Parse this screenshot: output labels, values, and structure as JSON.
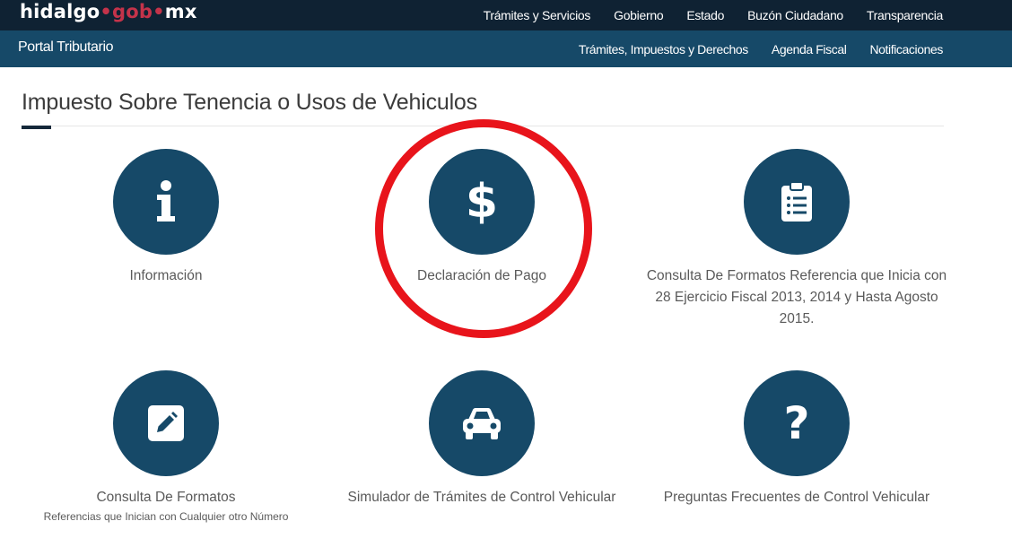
{
  "header": {
    "logo": {
      "part1": "hidalgo",
      "part2": "gob",
      "part3": "mx"
    },
    "nav": [
      "Trámites y Servicios",
      "Gobierno",
      "Estado",
      "Buzón Ciudadano",
      "Transparencia"
    ]
  },
  "subheader": {
    "title": "Portal Tributario",
    "nav": [
      "Trámites, Impuestos y Derechos",
      "Agenda Fiscal",
      "Notificaciones"
    ]
  },
  "page": {
    "title": "Impuesto Sobre Tenencia o Usos de Vehiculos"
  },
  "tiles": [
    {
      "label": "Información",
      "icon": "info-icon"
    },
    {
      "label": "Declaración de Pago",
      "icon": "dollar-icon"
    },
    {
      "label": "Consulta De Formatos Referencia que Inicia con 28 Ejercicio Fiscal 2013, 2014 y Hasta Agosto 2015.",
      "icon": "clipboard-list-icon"
    },
    {
      "label": "Consulta De Formatos",
      "sublabel": "Referencias que Inician con Cualquier otro Número",
      "icon": "edit-icon"
    },
    {
      "label": "Simulador de Trámites de Control Vehicular",
      "icon": "car-icon"
    },
    {
      "label": "Preguntas Frecuentes de Control Vehicular",
      "icon": "question-icon"
    }
  ],
  "colors": {
    "topbar": "#0f2233",
    "subbar": "#164968",
    "icon_circle": "#164968",
    "logo_accent": "#c4334a",
    "highlight": "#e8141b"
  }
}
